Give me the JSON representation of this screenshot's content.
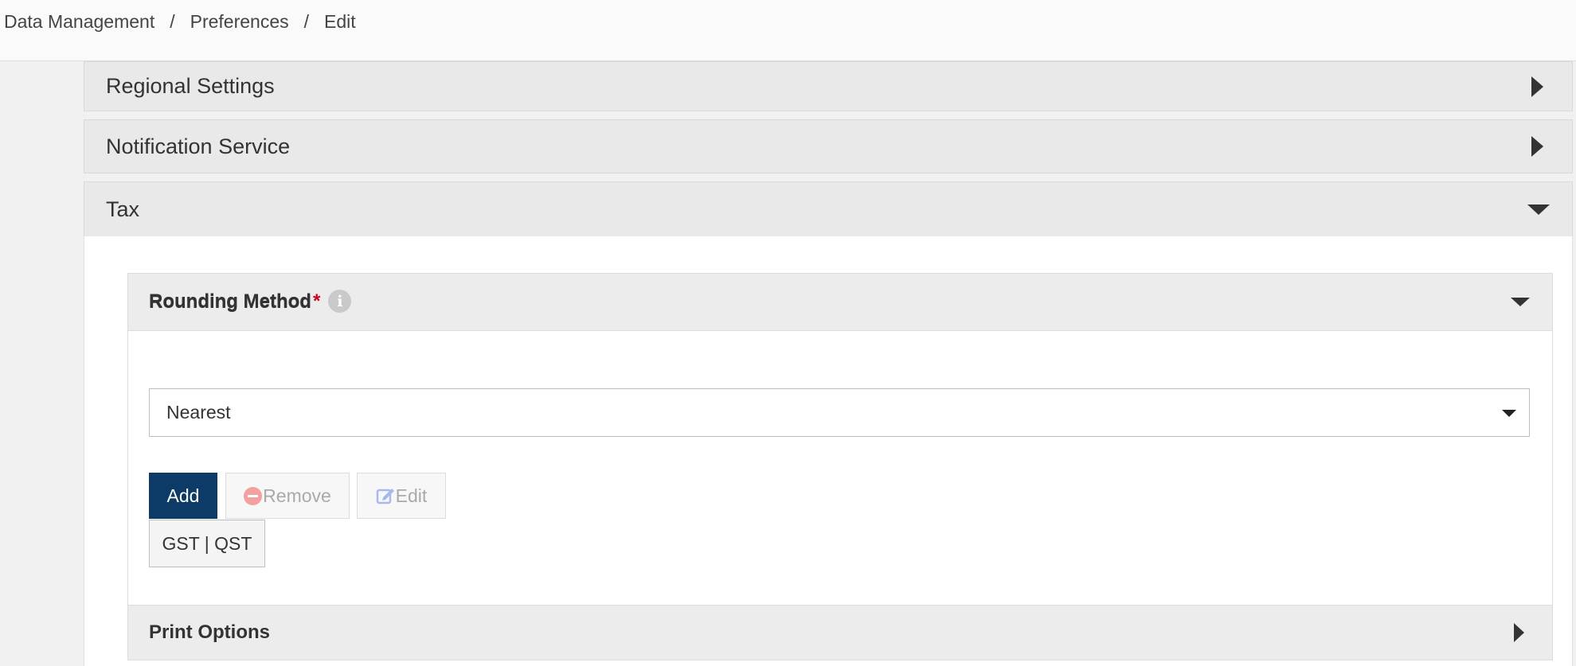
{
  "breadcrumb": {
    "items": [
      "Data Management",
      "Preferences",
      "Edit"
    ],
    "separator": "/"
  },
  "panels": {
    "regional": {
      "title": "Regional Settings",
      "state": "collapsed"
    },
    "notification": {
      "title": "Notification Service",
      "state": "collapsed"
    },
    "tax": {
      "title": "Tax",
      "state": "expanded"
    }
  },
  "tax": {
    "rounding_section": {
      "title": "Rounding Method",
      "state": "expanded"
    },
    "rounding_field": {
      "label": "Rounding Method",
      "required_mark": "*",
      "info_icon": "i",
      "selected_value": "Nearest"
    },
    "buttons": {
      "add": "Add",
      "remove": "Remove",
      "edit": "Edit"
    },
    "list_items": [
      "GST | QST"
    ],
    "print_section": {
      "title": "Print Options",
      "state": "collapsed"
    }
  },
  "colors": {
    "primary_button": "#0b3b66",
    "required": "#d0021b",
    "remove_icon": "#f3a0a0",
    "edit_icon": "#a9b8ec"
  },
  "icons": {
    "panel_collapsed": "caret-right-icon",
    "panel_expanded": "caret-down-icon",
    "info": "info-icon",
    "remove": "minus-circle-icon",
    "edit": "edit-square-icon",
    "select": "caret-down-icon"
  }
}
